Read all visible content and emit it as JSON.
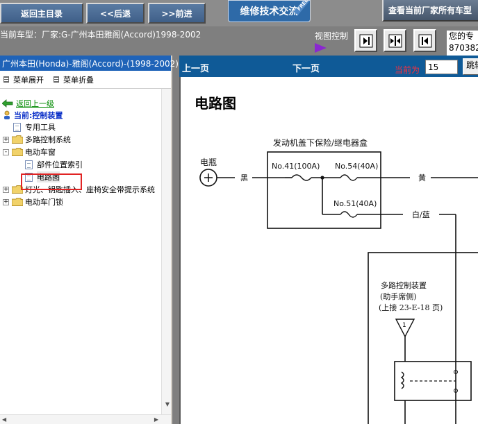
{
  "topbar": {
    "back_main": "返回主目录",
    "back": "<<后退",
    "forward": ">>前进",
    "exchange": "维修技术交流",
    "exchange_badge": "FREE",
    "view_all": "查看当前厂家所有车型"
  },
  "infoline": {
    "car_type": "当前车型：厂家:G-广州本田雅阁(Accord)1998-2002",
    "view_control": "视图控制",
    "user_line1": "您的专",
    "user_line2": "870382"
  },
  "left": {
    "header": "广州本田(Honda)-雅阁(Accord)-(1998-2002)",
    "expand_menu": "菜单展开",
    "collapse_menu": "菜单折叠",
    "back_up": "返回上一级",
    "current": "当前:控制装置",
    "tree": [
      {
        "label": "专用工具",
        "type": "doc",
        "level": 0
      },
      {
        "label": "多路控制系统",
        "type": "folder",
        "level": 0,
        "expander": "+"
      },
      {
        "label": "电动车窗",
        "type": "folder",
        "level": 0,
        "expander": "-"
      },
      {
        "label": "部件位置索引",
        "type": "doc",
        "level": 1
      },
      {
        "label": "电路图",
        "type": "doc",
        "level": 1,
        "selected": true
      },
      {
        "label": "灯光、钥匙插入、座椅安全带提示系统",
        "type": "folder",
        "level": 0,
        "expander": "+"
      },
      {
        "label": "电动车门锁",
        "type": "folder",
        "level": 0,
        "expander": "+"
      }
    ]
  },
  "right": {
    "prev": "上一页",
    "next": "下一页",
    "current_label": "当前为",
    "page": "15",
    "jump": "跳转"
  },
  "diagram": {
    "title": "电路图",
    "box_label": "发动机盖下保险/继电器盒",
    "battery": "电瓶",
    "fuse1": "No.41(100A)",
    "fuse2": "No.54(40A)",
    "fuse3": "No.51(40A)",
    "wire_black": "黑",
    "wire_yellow": "黄",
    "wire_white_blue": "白/蓝",
    "module_line1": "多路控制装置",
    "module_line2": "(助手席侧)",
    "module_line3": "(上接 23-E-18 页)",
    "marker": "1"
  },
  "colors": {
    "nav_blue": "#3f5f88",
    "left_header": "#1f63b8",
    "page_bar": "#0f5a97",
    "current_red": "#ff2e3b",
    "highlight_red": "#e12424",
    "link_green": "#008a00",
    "current_blue": "#0b30c8"
  }
}
